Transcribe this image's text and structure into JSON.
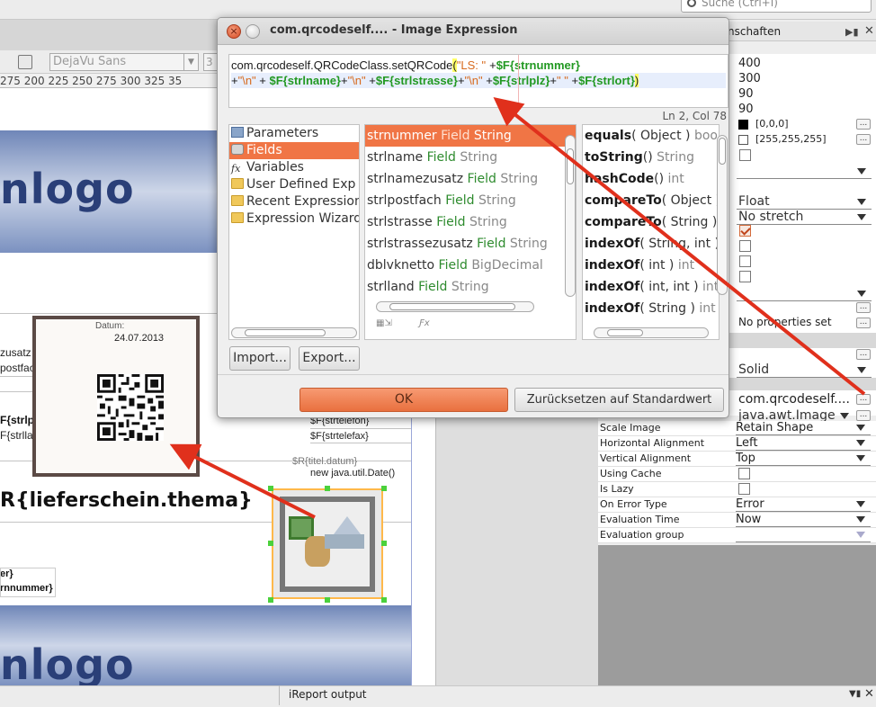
{
  "search": {
    "placeholder": "Suche (Ctrl+I)"
  },
  "toolbar": {
    "font": "DejaVu Sans",
    "size": "3"
  },
  "ruler": {
    "text": "275 200 225 250 275 300 325 35"
  },
  "canvas": {
    "logo_top": "nlogo",
    "logo_bottom": "nlogo",
    "left_fields": [
      "zusatz",
      "postfac",
      "F{strlp",
      "F{strlla"
    ],
    "telefon": "$F{strtelefon}",
    "telefax": "$F{strtelefax}",
    "datum_field": "$R{titel.datum}",
    "datum_expr": "new java.util.Date()",
    "thema": "R{lieferschein.thema}",
    "bottom_left_1": "er}",
    "bottom_left_2": "rnnummer}"
  },
  "qr_popup": {
    "label": "Datum:",
    "date": "24.07.2013"
  },
  "dialog": {
    "title": "com.qrcodeself.... - Image Expression",
    "expression": {
      "line1_prefix": "com.qrcodeself.QRCodeClass.setQRCode",
      "line1_open": "(",
      "line1_str": "\"LS: \"",
      "line1_plus": "+",
      "line1_field": "$F{strnummer}",
      "line2": [
        {
          "t": "+",
          "c": "plain"
        },
        {
          "t": "\"\\n\"",
          "c": "str"
        },
        {
          "t": " + ",
          "c": "plain"
        },
        {
          "t": "$F{strlname}",
          "c": "fld"
        },
        {
          "t": "+",
          "c": "plain"
        },
        {
          "t": "\"\\n\"",
          "c": "str"
        },
        {
          "t": " +",
          "c": "plain"
        },
        {
          "t": "$F{strlstrasse}",
          "c": "fld"
        },
        {
          "t": "+",
          "c": "plain"
        },
        {
          "t": "\"\\n\"",
          "c": "str"
        },
        {
          "t": " +",
          "c": "plain"
        },
        {
          "t": "$F{strlplz}",
          "c": "fld"
        },
        {
          "t": "+",
          "c": "plain"
        },
        {
          "t": "\" \"",
          "c": "str"
        },
        {
          "t": " +",
          "c": "plain"
        },
        {
          "t": "$F{strlort}",
          "c": "fld"
        }
      ],
      "line2_close": ")"
    },
    "cursor_pos": "Ln 2, Col 78",
    "categories": [
      {
        "label": "Parameters",
        "icon": "param"
      },
      {
        "label": "Fields",
        "icon": "fields",
        "selected": true
      },
      {
        "label": "Variables",
        "icon": "fx"
      },
      {
        "label": "User Defined Exp",
        "icon": "folder"
      },
      {
        "label": "Recent Expression",
        "icon": "folder"
      },
      {
        "label": "Expression Wizard",
        "icon": "folder"
      }
    ],
    "fields": [
      {
        "name": "strnummer",
        "kind": "Field",
        "type": "String",
        "selected": true
      },
      {
        "name": "strlname",
        "kind": "Field",
        "type": "String"
      },
      {
        "name": "strlnamezusatz",
        "kind": "Field",
        "type": "String"
      },
      {
        "name": "strlpostfach",
        "kind": "Field",
        "type": "String"
      },
      {
        "name": "strlstrasse",
        "kind": "Field",
        "type": "String"
      },
      {
        "name": "strlstrassezusatz",
        "kind": "Field",
        "type": "String"
      },
      {
        "name": "dblvknetto",
        "kind": "Field",
        "type": "BigDecimal"
      },
      {
        "name": "strlland",
        "kind": "Field",
        "type": "String"
      }
    ],
    "methods": [
      {
        "name": "equals",
        "args": "( Object )",
        "ret": "bool"
      },
      {
        "name": "toString",
        "args": "()",
        "ret": "String"
      },
      {
        "name": "hashCode",
        "args": "()",
        "ret": "int"
      },
      {
        "name": "compareTo",
        "args": "( Object )",
        "ret": ""
      },
      {
        "name": "compareTo",
        "args": "( String )",
        "ret": "i"
      },
      {
        "name": "indexOf",
        "args": "( String, int )",
        "ret": ""
      },
      {
        "name": "indexOf",
        "args": "( int )",
        "ret": "int"
      },
      {
        "name": "indexOf",
        "args": "( int, int )",
        "ret": "int"
      },
      {
        "name": "indexOf",
        "args": "( String )",
        "ret": "int"
      }
    ],
    "import_label": "Import...",
    "export_label": "Export...",
    "ok_label": "OK",
    "reset_label": "Zurücksetzen auf Standardwert"
  },
  "properties": {
    "header": "nschaften",
    "values_top": [
      "400",
      "300",
      "90",
      "90"
    ],
    "color1": "[0,0,0]",
    "color2": "[255,255,255]",
    "float": "Float",
    "stretch": "No stretch",
    "no_props": "No properties set",
    "solid": "Solid",
    "expression": "com.qrcodeself....",
    "class": "java.awt.Image",
    "rows": [
      {
        "k": "Scale Image",
        "v": "Retain Shape",
        "type": "select"
      },
      {
        "k": "Horizontal Alignment",
        "v": "Left",
        "type": "select"
      },
      {
        "k": "Vertical Alignment",
        "v": "Top",
        "type": "select"
      },
      {
        "k": "Using Cache",
        "v": "",
        "type": "check"
      },
      {
        "k": "Is Lazy",
        "v": "",
        "type": "check"
      },
      {
        "k": "On Error Type",
        "v": "Error",
        "type": "select"
      },
      {
        "k": "Evaluation Time",
        "v": "Now",
        "type": "select"
      },
      {
        "k": "Evaluation group",
        "v": "",
        "type": "select"
      }
    ]
  },
  "bottom": {
    "output": "iReport output"
  },
  "colors": {
    "accent": "#f07545",
    "arrow": "#e0301c"
  }
}
